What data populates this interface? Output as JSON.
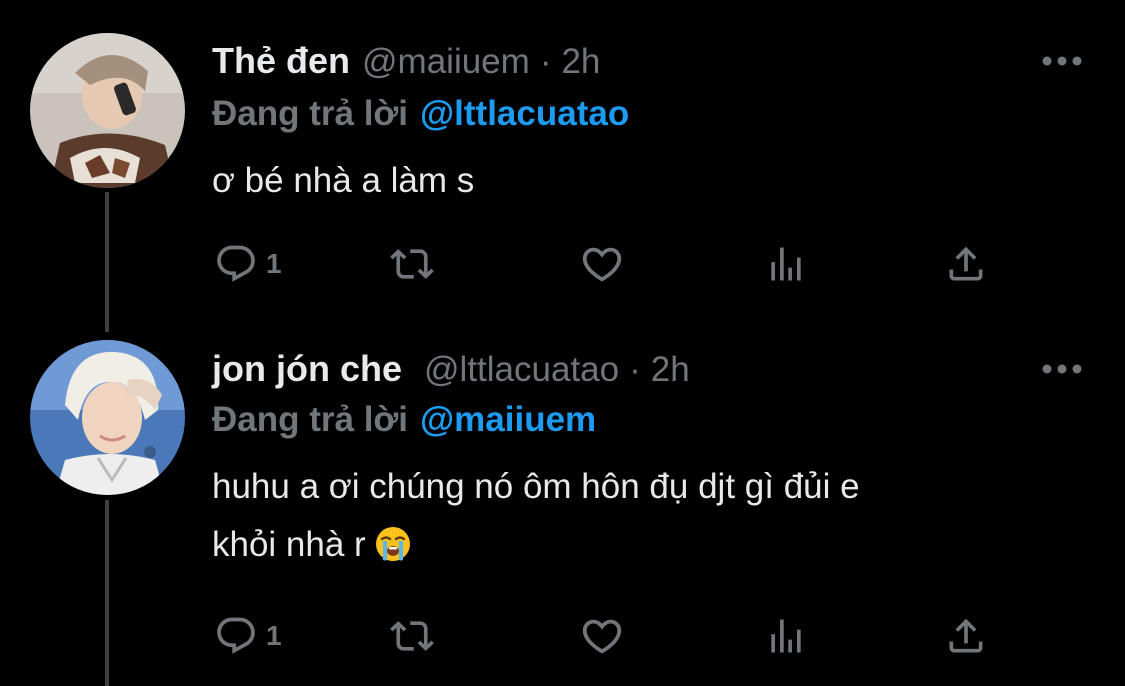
{
  "tweets": [
    {
      "display_name": "Thẻ đen",
      "handle": "@maiiuem",
      "separator": "·",
      "time": "2h",
      "reply_prefix": "Đang trả lời",
      "reply_to": "@lttlacuatao",
      "text": "ơ bé nhà a làm s",
      "reply_count": "1",
      "avatar_icon": "avatar-photo-icon"
    },
    {
      "display_name": "jon jón che",
      "handle": "@lttlacuatao",
      "separator": "·",
      "time": "2h",
      "reply_prefix": "Đang trả lời",
      "reply_to": "@maiiuem",
      "text_line1": "huhu a ơi chúng nó ôm hôn đụ djt gì đủi e",
      "text_line2": "khỏi nhà r",
      "emoji": "loudly-crying-face-icon",
      "reply_count": "1",
      "avatar_icon": "avatar-photo-icon"
    }
  ],
  "colors": {
    "background": "#000000",
    "primary_text": "#e7e9ea",
    "secondary_text": "#71767b",
    "mention": "#1d9bf0",
    "thread_line": "#3e4144"
  }
}
